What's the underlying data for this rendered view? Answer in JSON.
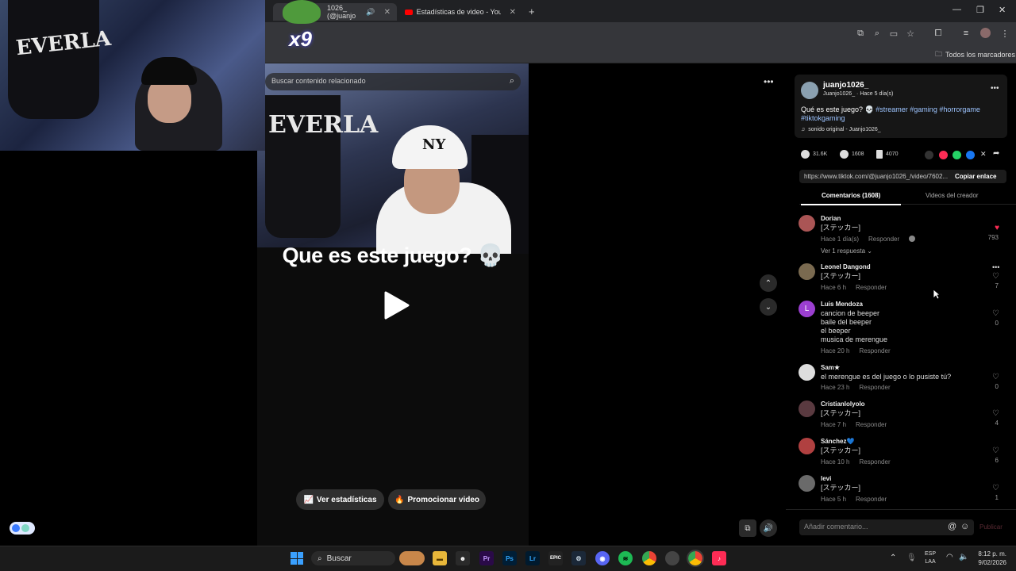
{
  "browser": {
    "tabs": [
      {
        "label": "1026_ (@juanjo"
      },
      {
        "label": "Estadísticas de video - YouTube"
      }
    ],
    "bookmarks_label": "Todos los marcadores"
  },
  "overlay": {
    "webcam_bag_text": "EVERLA",
    "badge_multiplier": "x9"
  },
  "video": {
    "search_placeholder": "Buscar contenido relacionado",
    "bag_text": "EVERLA",
    "cap_text": "NY",
    "title": "Que es este juego? 💀",
    "btn_stats": "Ver estadísticas",
    "btn_promote": "Promocionar video"
  },
  "post": {
    "username": "juanjo1026_",
    "subline": "Juanjo1026_ · Hace 5 día(s)",
    "caption_text": "Qué es este juego? 💀",
    "hashtags_line1": "#streamer #gaming #horrorgame",
    "hashtags_line2": "#tiktokgaming",
    "sound": "sonido original - Juanjo1026_",
    "likes": "31.6K",
    "comments": "1608",
    "saves": "4070",
    "url": "https://www.tiktok.com/@juanjo1026_/video/7602...",
    "copy_link": "Copiar enlace",
    "tab_comments": "Comentarios (1608)",
    "tab_creator": "Videos del creador"
  },
  "comments": [
    {
      "name": "Dorian",
      "text": [
        "[ステッカー]"
      ],
      "time": "Hace 1 día(s)",
      "reply": "Responder",
      "likes": "793",
      "liked": true,
      "extra": "Ver 1 respuesta ⌄"
    },
    {
      "name": "Leonel Dangond",
      "text": [
        "[ステッカー]"
      ],
      "time": "Hace 6 h",
      "reply": "Responder",
      "likes": "7",
      "liked": false
    },
    {
      "name": "Luis Mendoza",
      "text": [
        "cancion de beeper",
        "baile del beeper",
        "el beeper",
        "musica de merengue"
      ],
      "time": "Hace 20 h",
      "reply": "Responder",
      "likes": "0",
      "liked": false,
      "initial": "L"
    },
    {
      "name": "Sam★",
      "text": [
        "el merengue es del juego o lo pusiste tú?"
      ],
      "time": "Hace 23 h",
      "reply": "Responder",
      "likes": "0",
      "liked": false
    },
    {
      "name": "Cristianlolyolo",
      "text": [
        "[ステッカー]"
      ],
      "time": "Hace 7 h",
      "reply": "Responder",
      "likes": "4",
      "liked": false
    },
    {
      "name": "Sánchez💙",
      "text": [
        "[ステッカー]"
      ],
      "time": "Hace 10 h",
      "reply": "Responder",
      "likes": "6",
      "liked": false
    },
    {
      "name": "levi",
      "text": [
        "[ステッカー]"
      ],
      "time": "Hace 5 h",
      "reply": "Responder",
      "likes": "1",
      "liked": false
    }
  ],
  "comment_input": {
    "placeholder": "Añadir comentario...",
    "post_label": "Publicar"
  },
  "taskbar": {
    "search_label": "Buscar",
    "lang1": "ESP",
    "lang2": "LAA",
    "time": "8:12 p. m.",
    "date": "9/02/2026"
  }
}
